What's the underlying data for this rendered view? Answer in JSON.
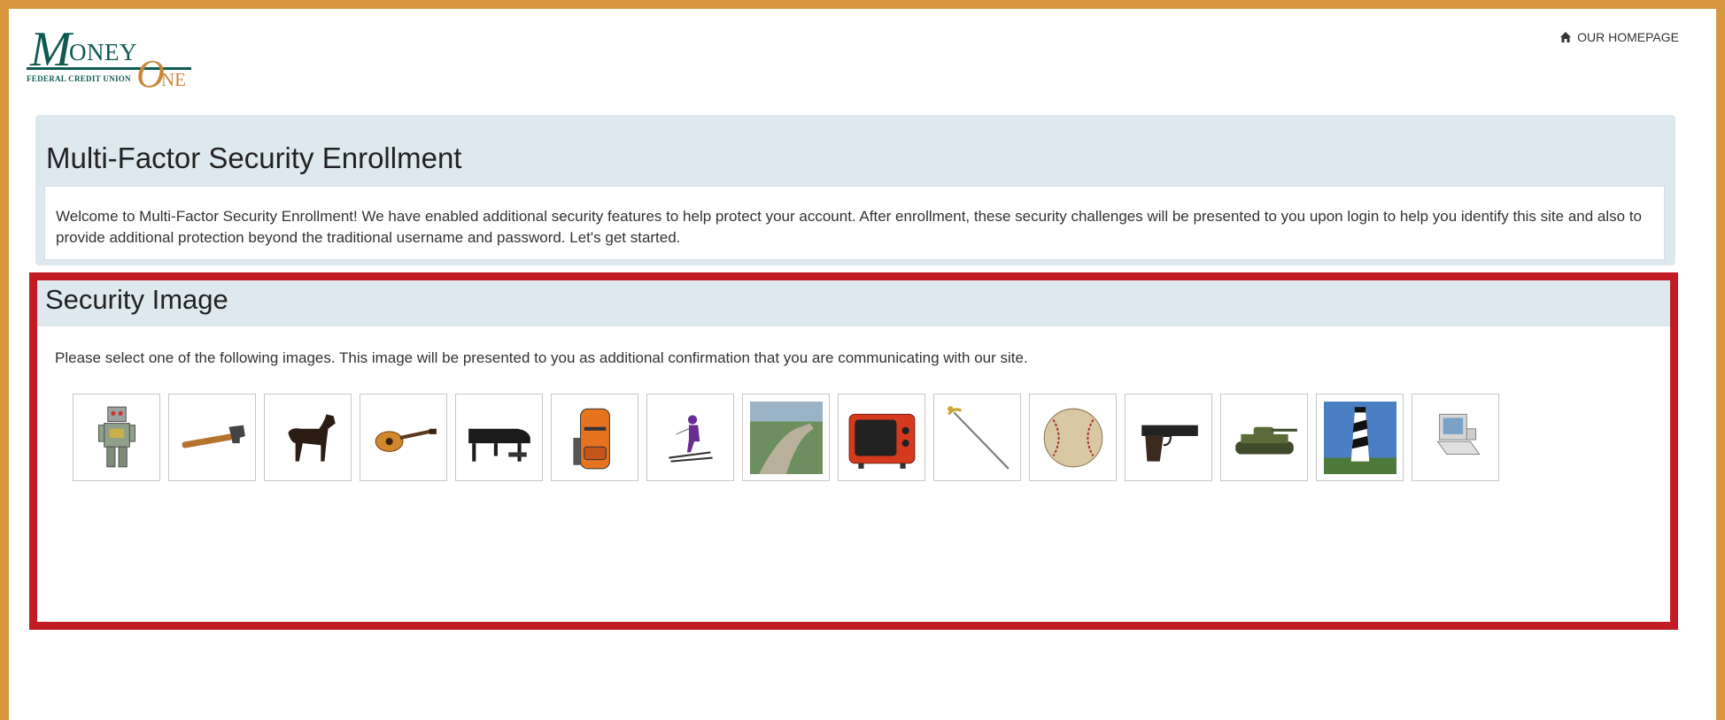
{
  "brand": {
    "logo_m": "M",
    "logo_oney": "ONEY",
    "logo_subtitle": "FEDERAL CREDIT UNION",
    "logo_o": "O",
    "logo_ne": "NE"
  },
  "header": {
    "home_link": "OUR HOMEPAGE",
    "home_icon": "home-icon"
  },
  "enrollment": {
    "title": "Multi-Factor Security Enrollment",
    "welcome": "Welcome to Multi-Factor Security Enrollment! We have enabled additional security features to help protect your account. After enrollment, these security challenges will be presented to you upon login to help you identify this site and also to provide additional protection beyond the traditional username and password. Let's get started."
  },
  "security_image": {
    "title": "Security Image",
    "instructions": "Please select one of the following images. This image will be presented to you as additional confirmation that you are communicating with our site.",
    "images": [
      "robot",
      "hammer",
      "dog",
      "guitar",
      "piano",
      "backpack",
      "skier",
      "great-wall",
      "television",
      "sword",
      "baseball",
      "pistol",
      "tank",
      "lighthouse",
      "computer"
    ]
  },
  "colors": {
    "frame": "#d8963c",
    "highlight": "#c21b24",
    "panel_header": "#dde9ee",
    "brand_green": "#0f5b52",
    "brand_gold": "#c9873a"
  }
}
